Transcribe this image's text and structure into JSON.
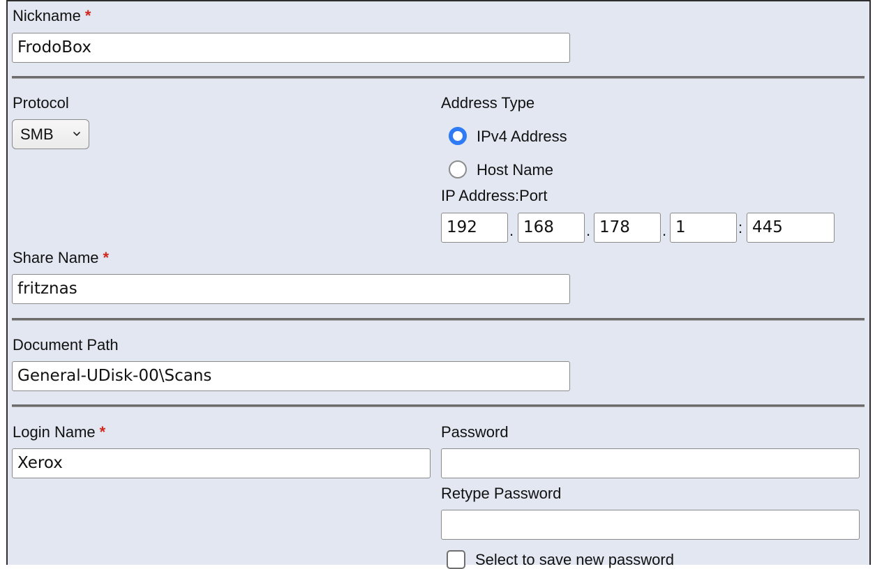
{
  "nickname": {
    "label": "Nickname",
    "required_mark": "*",
    "value": "FrodoBox"
  },
  "protocol": {
    "label": "Protocol",
    "selected": "SMB",
    "chevron_icon": "chevron-down-icon"
  },
  "address_type": {
    "label": "Address Type",
    "options": [
      {
        "label": "IPv4 Address",
        "checked": true
      },
      {
        "label": "Host Name",
        "checked": false
      }
    ]
  },
  "ip_address": {
    "label": "IP Address:Port",
    "octets": [
      "192",
      "168",
      "178",
      "1"
    ],
    "dot_separator": ".",
    "port_separator": ":",
    "port": "445"
  },
  "share_name": {
    "label": "Share Name",
    "required_mark": "*",
    "value": "fritznas"
  },
  "document_path": {
    "label": "Document Path",
    "value": "General-UDisk-00\\Scans"
  },
  "login_name": {
    "label": "Login Name",
    "required_mark": "*",
    "value": "Xerox"
  },
  "password": {
    "label": "Password",
    "value": ""
  },
  "retype_password": {
    "label": "Retype Password",
    "value": ""
  },
  "save_password": {
    "label": "Select to save new password",
    "checked": false
  },
  "colors": {
    "panel_background": "#e2e7f1",
    "required_asterisk": "#d0271d",
    "radio_selected": "#2f7bf5"
  }
}
